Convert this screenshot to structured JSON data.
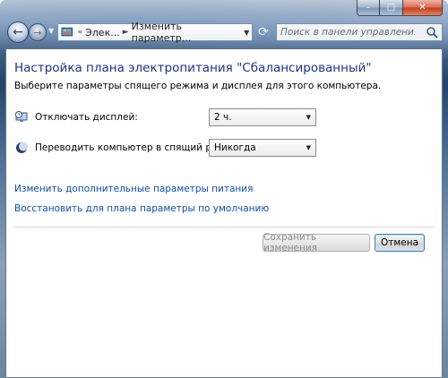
{
  "window": {
    "controls": {
      "minimize": "–",
      "maximize": "□",
      "close": "✕"
    }
  },
  "nav": {
    "back_icon": "back-arrow-icon",
    "forward_icon": "forward-arrow-icon",
    "breadcrumb": [
      "Элек...",
      "Изменить параметр..."
    ],
    "search_placeholder": "Поиск в панели управления"
  },
  "content": {
    "title": "Настройка плана электропитания \"Сбалансированный\"",
    "subtitle": "Выберите параметры спящего режима и дисплея для этого компьютера.",
    "settings": [
      {
        "label": "Отключать дисплей:",
        "value": "2 ч.",
        "icon": "monitor-clock-icon"
      },
      {
        "label": "Переводить компьютер в спящий режим:",
        "value": "Никогда",
        "icon": "moon-icon"
      }
    ],
    "links": [
      "Изменить дополнительные параметры питания",
      "Восстановить для плана параметры по умолчанию"
    ],
    "buttons": {
      "save": "Сохранить изменения",
      "cancel": "Отмена"
    }
  },
  "colors": {
    "title": "#1e3287",
    "link": "#0b4ea9"
  }
}
